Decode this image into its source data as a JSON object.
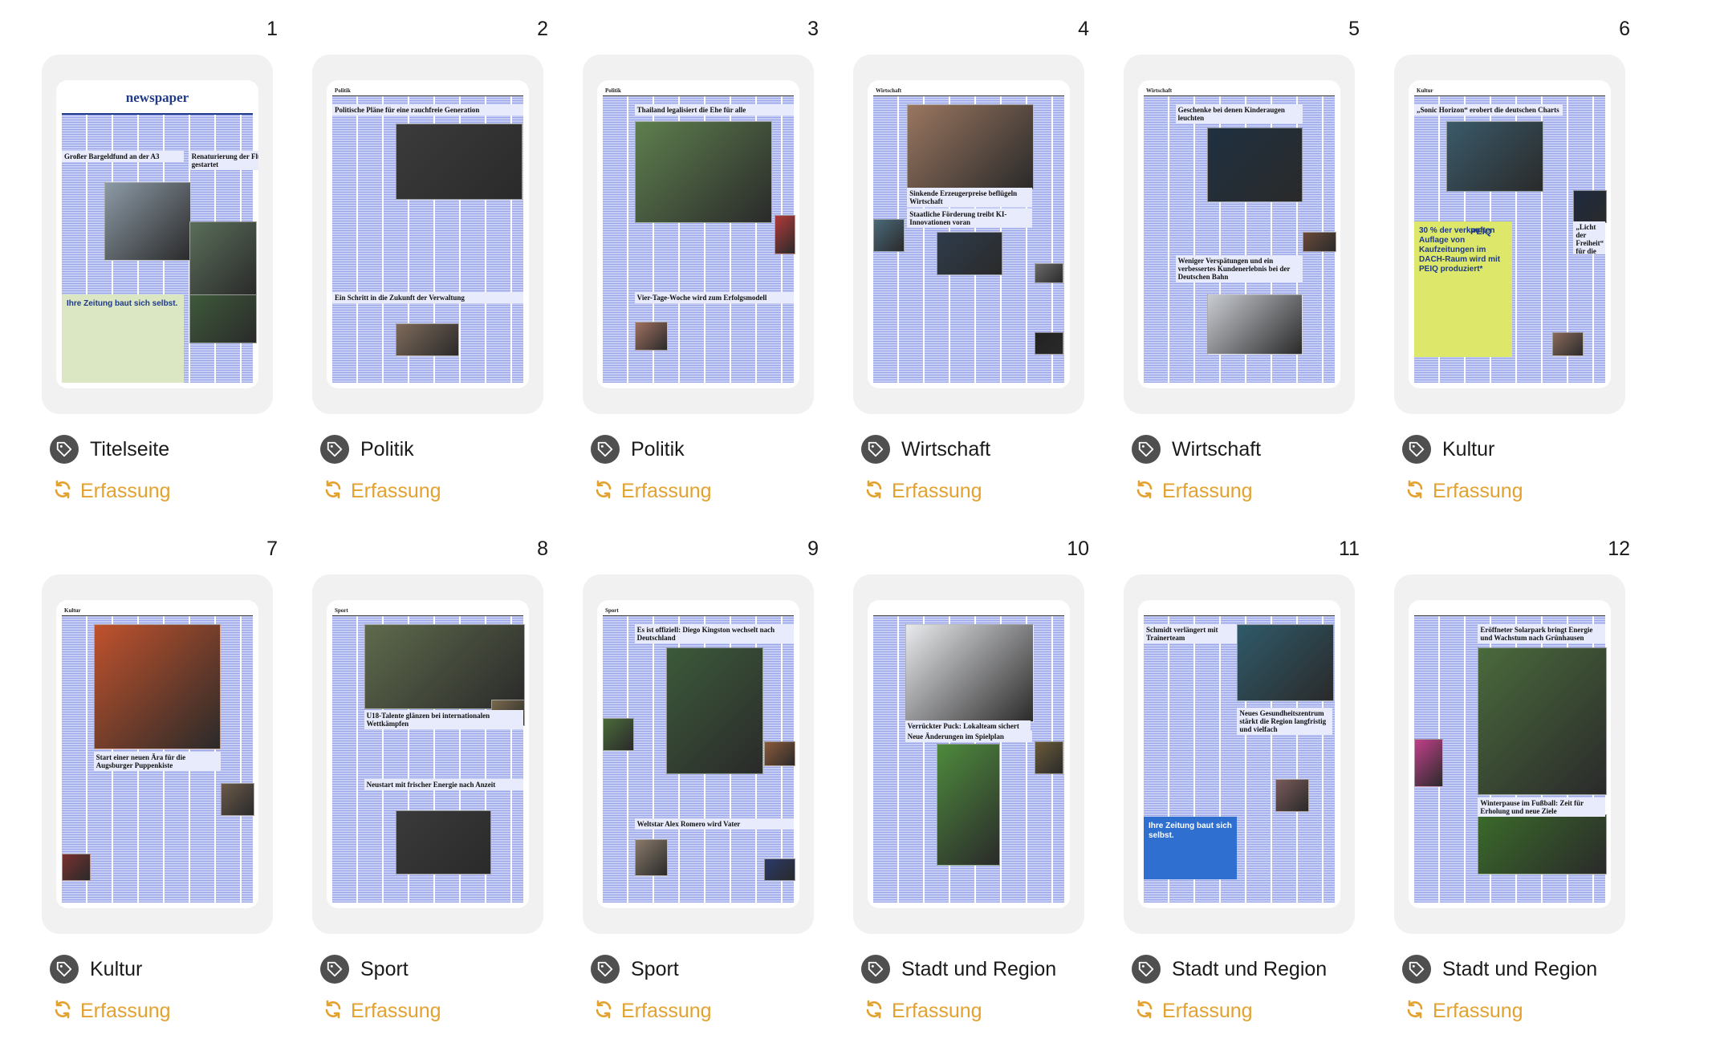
{
  "status_color": "#e3a12f",
  "pages": [
    {
      "number": "1",
      "category": "Titelseite",
      "status": "Erfassung",
      "variant": "title",
      "masthead": "newspaper",
      "headlines": [
        "Großer Bargeldfund an der A3",
        "Renaturierung der Flussauen gestartet"
      ],
      "ad_text": "Ihre Zeitung baut sich selbst."
    },
    {
      "number": "2",
      "category": "Politik",
      "status": "Erfassung",
      "variant": "politik1",
      "section": "Politik",
      "headlines": [
        "Politische Pläne für eine rauchfreie Generation",
        "Ein Schritt in die Zukunft der Verwaltung"
      ]
    },
    {
      "number": "3",
      "category": "Politik",
      "status": "Erfassung",
      "variant": "politik2",
      "section": "Politik",
      "headlines": [
        "Thailand legalisiert die Ehe für alle",
        "Vier-Tage-Woche wird zum Erfolgsmodell"
      ]
    },
    {
      "number": "4",
      "category": "Wirtschaft",
      "status": "Erfassung",
      "variant": "wirt1",
      "section": "Wirtschaft",
      "headlines": [
        "Sinkende Erzeugerpreise beflügeln Wirtschaft",
        "Staatliche Förderung treibt KI-Innovationen voran"
      ]
    },
    {
      "number": "5",
      "category": "Wirtschaft",
      "status": "Erfassung",
      "variant": "wirt2",
      "section": "Wirtschaft",
      "headlines": [
        "Geschenke bei denen Kinderaugen leuchten",
        "Weniger Verspätungen und ein verbessertes Kundenerlebnis bei der Deutschen Bahn"
      ]
    },
    {
      "number": "6",
      "category": "Kultur",
      "status": "Erfassung",
      "variant": "kultur1",
      "section": "Kultur",
      "headlines": [
        "„Sonic Horizon“ erobert die deutschen Charts",
        "„Licht der Freiheit“ für die Oscars nominiert"
      ],
      "ad_text": "30 % der verkauften Auflage von Kaufzeitungen im DACH-Raum wird mit PEIQ produziert*",
      "ad_brand": "PEIQ"
    },
    {
      "number": "7",
      "category": "Kultur",
      "status": "Erfassung",
      "variant": "kultur2",
      "section": "Kultur",
      "headlines": [
        "Start einer neuen Ära für die Augsburger Puppenkiste"
      ]
    },
    {
      "number": "8",
      "category": "Sport",
      "status": "Erfassung",
      "variant": "sport1",
      "section": "Sport",
      "headlines": [
        "U18-Talente glänzen bei internationalen Wettkämpfen",
        "Neustart mit frischer Energie nach Anzeit"
      ]
    },
    {
      "number": "9",
      "category": "Sport",
      "status": "Erfassung",
      "variant": "sport2",
      "section": "Sport",
      "headlines": [
        "Es ist offiziell: Diego Kingston wechselt nach Deutschland",
        "Weltstar Alex Romero wird Vater"
      ]
    },
    {
      "number": "10",
      "category": "Stadt und Region",
      "status": "Erfassung",
      "variant": "stadt1",
      "section": "",
      "headlines": [
        "Verrückter Puck: Lokalteam sichert sich den ersten Platz",
        "Neue Änderungen im Spielplan"
      ]
    },
    {
      "number": "11",
      "category": "Stadt und Region",
      "status": "Erfassung",
      "variant": "stadt2",
      "section": "",
      "headlines": [
        "Schmidt verlängert mit Trainerteam",
        "Neues Gesundheitszentrum stärkt die Region langfristig und vielfach"
      ],
      "ad_text": "Ihre Zeitung baut sich selbst."
    },
    {
      "number": "12",
      "category": "Stadt und Region",
      "status": "Erfassung",
      "variant": "stadt3",
      "section": "",
      "headlines": [
        "Eröffneter Solarpark bringt Energie und Wachstum nach Grünhausen",
        "Winterpause im Fußball: Zeit für Erholung und neue Ziele"
      ]
    }
  ]
}
